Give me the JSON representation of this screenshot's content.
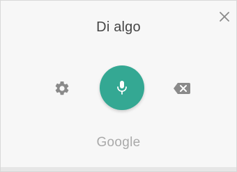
{
  "dialog": {
    "prompt": "Di algo",
    "brand": "Google"
  },
  "icons": {
    "close": "close-icon",
    "settings": "gear-icon",
    "microphone": "microphone-icon",
    "backspace": "backspace-icon"
  },
  "colors": {
    "panel_background": "#f7f7f7",
    "mic_button": "#34a893",
    "icon_gray": "#8a8a8a",
    "prompt_text": "#454545",
    "brand_text": "#a9a9a9"
  }
}
